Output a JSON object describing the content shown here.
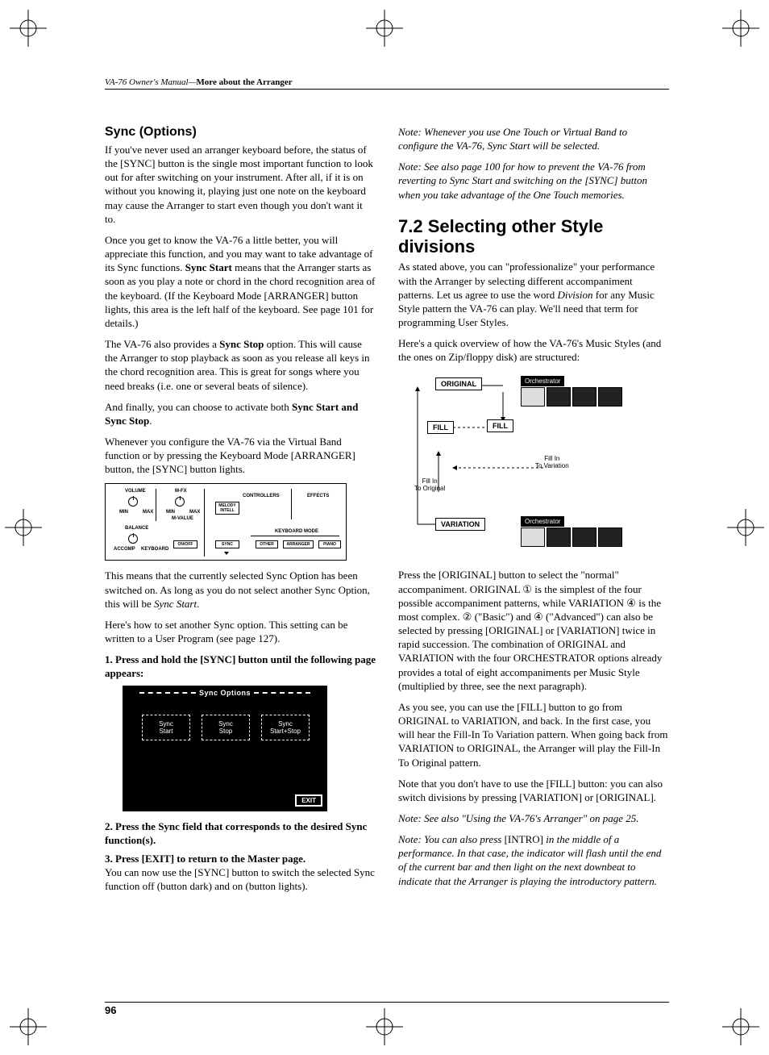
{
  "header": {
    "manual": "VA-76 Owner's Manual—",
    "section": "More about the Arranger"
  },
  "left": {
    "h_sync": "Sync (Options)",
    "p1": "If you've never used an arranger keyboard before, the status of the [SYNC] button is the single most important function to look out for after switching on your instrument. After all, if it is on without you knowing it, playing just one note on the keyboard may cause the Arranger to start even though you don't want it to.",
    "p2a": "Once you get to know the VA-76 a little better, you will appreciate this function, and you may want to take advantage of its Sync functions. ",
    "p2b": "Sync Start",
    "p2c": " means that the Arranger starts as soon as you play a note or chord in the chord recognition area of the keyboard. (If the Keyboard Mode [ARRANGER] button lights, this area is the left half of the keyboard. See page 101 for details.)",
    "p3a": "The VA-76 also provides a ",
    "p3b": "Sync Stop",
    "p3c": " option. This will cause the Arranger to stop playback as soon as you release all keys in the chord recognition area. This is great for songs where you need breaks (i.e. one or several beats of silence).",
    "p4a": "And finally, you can choose to activate both ",
    "p4b": "Sync Start and Sync Stop",
    "p4c": ".",
    "p5": "Whenever you configure the VA-76 via the Virtual Band function or by pressing the Keyboard Mode [ARRANGER] button, the [SYNC] button lights.",
    "p6a": "This means that the currently selected Sync Option has been switched on. As long as you do not select another Sync Option, this will be ",
    "p6b": "Sync Start",
    "p6c": ".",
    "p7": "Here's how to set another Sync option. This setting can be written to a User Program (see page 127).",
    "s1": "1. Press and hold the [SYNC] button until the following page appears:",
    "s2": "2. Press the Sync field that corresponds to the desired Sync function(s).",
    "s3a": "3. Press [EXIT] to return to the Master page.",
    "s3b": "You can now use the [SYNC] button to switch the selected Sync function off (button dark) and on (button lights).",
    "panel": {
      "volume": "VOLUME",
      "mfx": "M-FX",
      "controllers": "CONTROLLERS",
      "effects": "EFFECTS",
      "melody": "MELODY INTELL",
      "balance": "BALANCE",
      "keyboard_mode": "KEYBOARD MODE",
      "onoff": "ON/OFF",
      "sync": "SYNC",
      "other": "OTHER",
      "arranger": "ARRANGER",
      "piano": "PIANO",
      "min": "MIN",
      "max": "MAX",
      "accomp": "ACCOMP",
      "keyboard": "KEYBOARD",
      "mvalue": "M-VALUE"
    },
    "lcd": {
      "title": "Sync Options",
      "opt1a": "Sync",
      "opt1b": "Start",
      "opt2a": "Sync",
      "opt2b": "Stop",
      "opt3a": "Sync",
      "opt3b": "Start+Stop",
      "exit": "EXIT"
    }
  },
  "right": {
    "n1": "Note: Whenever you use One Touch or Virtual Band to configure the VA-76, Sync Start will be selected.",
    "n2": "Note: See also page 100 for how to prevent the VA-76 from reverting to Sync Start and switching on the [SYNC] button when you take advantage of the One Touch memories.",
    "h": "7.2 Selecting other Style divisions",
    "p1a": "As stated above, you can \"professionalize\" your performance with the Arranger by selecting different accompaniment patterns. Let us agree to use the word ",
    "p1b": "Division",
    "p1c": " for any Music Style pattern the VA-76 can play. We'll need that term for programming User Styles.",
    "p2": "Here's a quick overview of how the VA-76's Music Styles (and the ones on Zip/floppy disk) are structured:",
    "flow": {
      "original": "ORIGINAL",
      "variation": "VARIATION",
      "fill": "FILL",
      "fi_var": "Fill In\nTo Variation",
      "fi_orig": "Fill In\nTo Original",
      "orch": "Orchestrator"
    },
    "p3": "Press the [ORIGINAL] button to select the \"normal\" accompaniment. ORIGINAL ① is the simplest of the four possible accompaniment patterns, while VARIATION ④ is the most complex. ② (\"Basic\") and ④ (\"Advanced\") can also be selected by pressing [ORIGINAL] or [VARIATION] twice in rapid succession. The combination of ORIGINAL and VARIATION with the four ORCHESTRATOR options already provides a total of eight accompaniments per Music Style (multiplied by three, see the next paragraph).",
    "p4": "As you see, you can use the [FILL] button to go from ORIGINAL to VARIATION, and back. In the first case, you will hear the Fill-In To Variation pattern. When going back from VARIATION to ORIGINAL, the Arranger will play the Fill-In To Original pattern.",
    "p5": "Note that you don't have to use the [FILL] button: you can also switch divisions by pressing [VARIATION] or [ORIGINAL].",
    "n3": "Note: See also \"Using the VA-76's Arranger\" on page 25.",
    "n4a": "Note: You can also press ",
    "n4b": "[INTRO]",
    "n4c": " in the middle of a performance. In that case, the indicator will flash until the end of the current bar and then light on the next downbeat to indicate that the Arranger is playing the introductory pattern."
  },
  "pagenum": "96"
}
